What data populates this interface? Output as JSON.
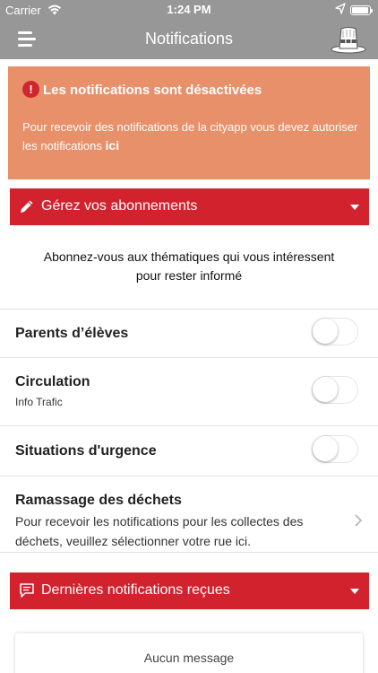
{
  "status_bar": {
    "carrier": "Carrier",
    "time": "1:24 PM",
    "battery_level": 0.95
  },
  "nav": {
    "title": "Notifications",
    "menu_icon": "menu-icon",
    "logo_icon": "hat-logo"
  },
  "alert": {
    "icon": "!",
    "title": "Les notifications sont désactivées",
    "text": "Pour recevoir des notifications de la cityapp vous devez autoriser les notifications",
    "link": "ici"
  },
  "subscriptions_header": {
    "label": "Gérez vos abonnements",
    "icon": "pencil-icon"
  },
  "intro": {
    "line1": "Abonnez-vous aux thématiques qui vous intéressent",
    "line2": "pour rester informé"
  },
  "topics": [
    {
      "title": "Parents d’élèves",
      "subtitle": "",
      "enabled": false
    },
    {
      "title": "Circulation",
      "subtitle": "Info Trafic",
      "enabled": false
    },
    {
      "title": "Situations d'urgence",
      "subtitle": "",
      "enabled": false
    }
  ],
  "waste": {
    "title": "Ramassage des déchets",
    "line1": "Pour recevoir les notifications pour les collectes des",
    "line2": "déchets, veuillez sélectionner votre rue ici."
  },
  "recent_header": {
    "label": "Dernières notifications reçues",
    "icon": "message-icon"
  },
  "messages": {
    "empty_text": "Aucun message"
  },
  "colors": {
    "bar_gray": "#979797",
    "alert_orange": "#e8906a",
    "section_red": "#d2222e"
  }
}
